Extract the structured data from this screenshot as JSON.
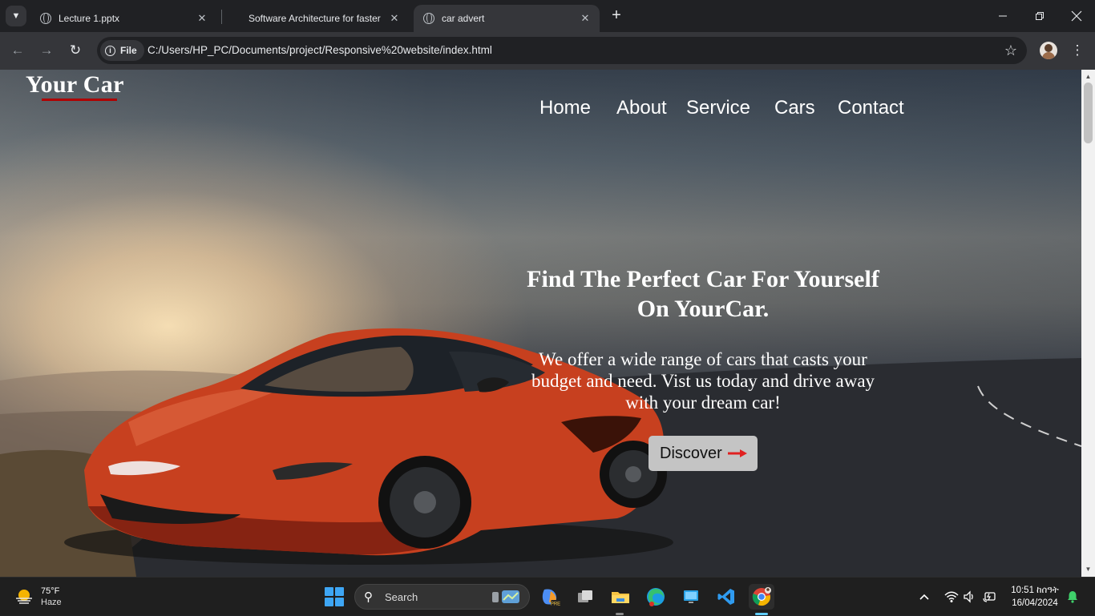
{
  "browser": {
    "tabs": [
      {
        "title": "Lecture 1.pptx"
      },
      {
        "title": "Software Architecture for faster"
      },
      {
        "title": "car advert"
      }
    ],
    "address": {
      "scheme_label": "File",
      "url": "C:/Users/HP_PC/Documents/project/Responsive%20website/index.html"
    }
  },
  "page": {
    "logo": "Your Car",
    "nav": [
      "Home",
      "About",
      "Service",
      "Cars",
      "Contact"
    ],
    "hero": {
      "title": "Find The Perfect Car For Yourself On YourCar.",
      "text": "We offer a wide range of cars that casts your budget and need. Vist us today and drive away with your dream car!",
      "button_label": "Discover"
    }
  },
  "taskbar": {
    "weather": {
      "temp": "75°F",
      "condition": "Haze"
    },
    "search_label": "Search",
    "clock": {
      "time": "10:51 ከሰዓት",
      "date": "16/04/2024"
    }
  },
  "colors": {
    "accent_underline": "#b00000",
    "button_bg": "#c4c4c4",
    "arrow": "#e02020",
    "car_body": "#c7401f"
  }
}
